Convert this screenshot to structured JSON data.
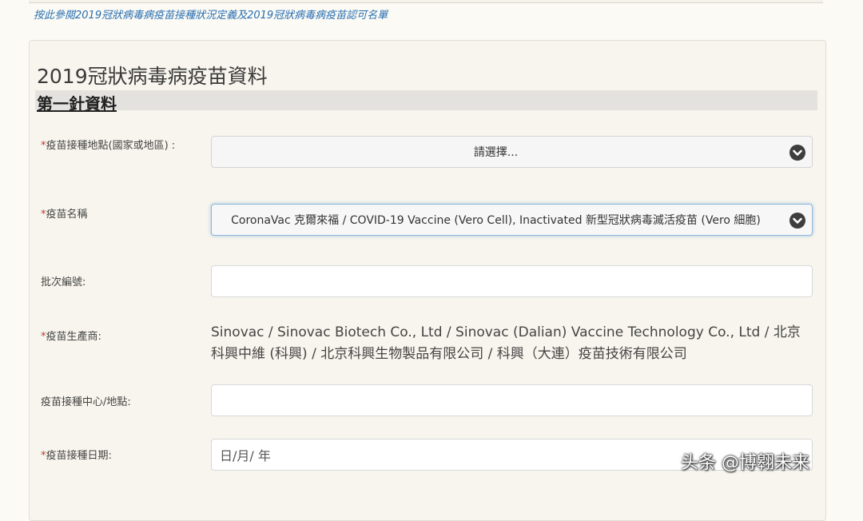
{
  "top_link": "按此參閱2019冠狀病毒病疫苗接種狀況定義及2019冠狀病毒病疫苗認可名單",
  "section": {
    "title": "2019冠狀病毒病疫苗資料",
    "subheader": "第一針資料"
  },
  "fields": {
    "location": {
      "required": "*",
      "label": "疫苗接種地點(國家或地區) :",
      "value": "請選擇..."
    },
    "vaccine_name": {
      "required": "*",
      "label": "疫苗名稱",
      "value": "CoronaVac 克爾來福 / COVID-19 Vaccine (Vero Cell), Inactivated 新型冠狀病毒滅活疫苗 (Vero 細胞)"
    },
    "batch": {
      "label": "批次編號:",
      "value": ""
    },
    "manufacturer": {
      "required": "*",
      "label": "疫苗生產商:",
      "value": "Sinovac / Sinovac Biotech Co., Ltd / Sinovac (Dalian) Vaccine Technology Co., Ltd / 北京科興中維 (科興) / 北京科興生物製品有限公司 / 科興（大連）疫苗技術有限公司"
    },
    "center": {
      "label": "疫苗接種中心/地點:",
      "value": ""
    },
    "date": {
      "required": "*",
      "label": "疫苗接種日期:",
      "placeholder": "日/月/ 年"
    }
  },
  "icons": {
    "dropdown": "chevron-down-icon"
  },
  "colors": {
    "link": "#2a6fb0",
    "required": "#c0392b",
    "focus": "#8fb7dc"
  },
  "watermark": "头条 @博翱未来"
}
